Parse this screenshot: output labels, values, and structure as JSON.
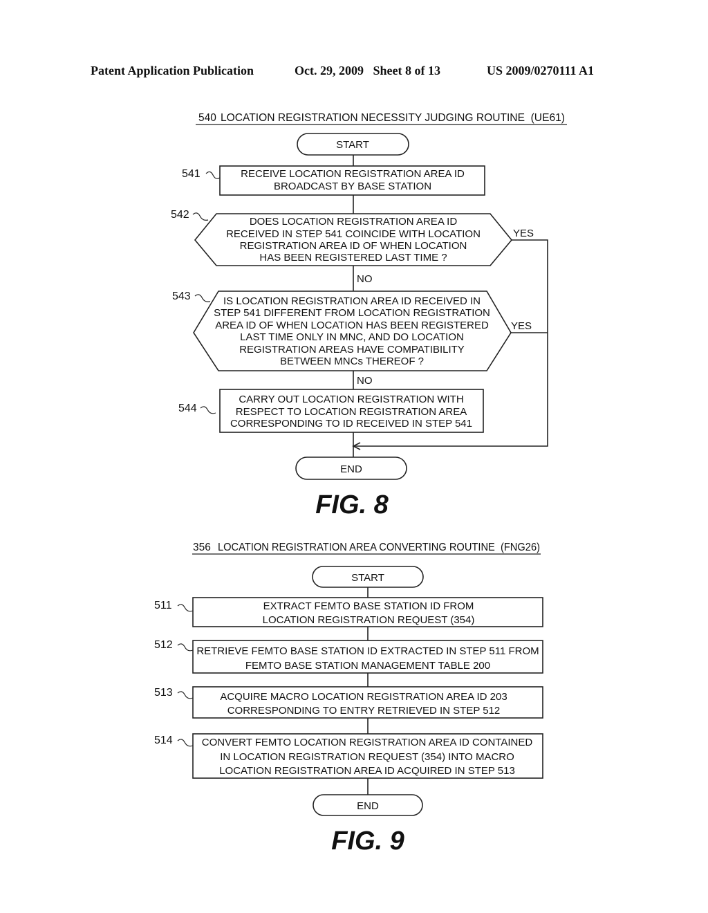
{
  "header": {
    "publication": "Patent Application Publication",
    "date_sheet": "Oct. 29, 2009   Sheet 8 of 13",
    "number": "US 2009/0270111 A1"
  },
  "fig8": {
    "title_number": "540",
    "title_text": "LOCATION REGISTRATION NECESSITY JUDGING ROUTINE  (UE61)",
    "start": "START",
    "end": "END",
    "caption": "FIG. 8",
    "steps": [
      {
        "id": "541",
        "type": "process",
        "lines": [
          "RECEIVE LOCATION REGISTRATION AREA ID",
          "BROADCAST BY BASE STATION"
        ]
      },
      {
        "id": "542",
        "type": "decision",
        "lines": [
          "DOES LOCATION REGISTRATION AREA ID",
          "RECEIVED IN STEP 541 COINCIDE WITH LOCATION",
          "REGISTRATION AREA ID OF WHEN LOCATION",
          "HAS BEEN REGISTERED LAST TIME ?"
        ],
        "yes": "YES",
        "no": "NO"
      },
      {
        "id": "543",
        "type": "decision",
        "lines": [
          "IS LOCATION REGISTRATION AREA ID RECEIVED IN",
          "STEP 541 DIFFERENT FROM LOCATION REGISTRATION",
          "AREA ID OF WHEN LOCATION HAS BEEN REGISTERED",
          "LAST TIME ONLY IN MNC, AND DO LOCATION",
          "REGISTRATION AREAS HAVE COMPATIBILITY",
          "BETWEEN MNCs THEREOF ?"
        ],
        "yes": "YES",
        "no": "NO"
      },
      {
        "id": "544",
        "type": "process",
        "lines": [
          "CARRY OUT LOCATION REGISTRATION WITH",
          "RESPECT TO LOCATION REGISTRATION AREA",
          "CORRESPONDING TO ID RECEIVED IN STEP 541"
        ]
      }
    ]
  },
  "fig9": {
    "title_number": "356",
    "title_text": "LOCATION REGISTRATION AREA CONVERTING ROUTINE  (FNG26)",
    "start": "START",
    "end": "END",
    "caption": "FIG. 9",
    "steps": [
      {
        "id": "511",
        "type": "process",
        "lines": [
          "EXTRACT FEMTO BASE STATION ID FROM",
          "LOCATION REGISTRATION REQUEST (354)"
        ]
      },
      {
        "id": "512",
        "type": "process",
        "lines": [
          "RETRIEVE FEMTO BASE STATION ID EXTRACTED IN STEP 511 FROM",
          "FEMTO BASE STATION MANAGEMENT TABLE 200"
        ]
      },
      {
        "id": "513",
        "type": "process",
        "lines": [
          "ACQUIRE MACRO LOCATION REGISTRATION AREA ID 203",
          "CORRESPONDING TO ENTRY RETRIEVED IN STEP 512"
        ]
      },
      {
        "id": "514",
        "type": "process",
        "lines": [
          "CONVERT FEMTO LOCATION REGISTRATION AREA ID CONTAINED",
          "IN LOCATION REGISTRATION REQUEST (354) INTO MACRO",
          "LOCATION REGISTRATION AREA ID ACQUIRED IN STEP 513"
        ]
      }
    ]
  }
}
